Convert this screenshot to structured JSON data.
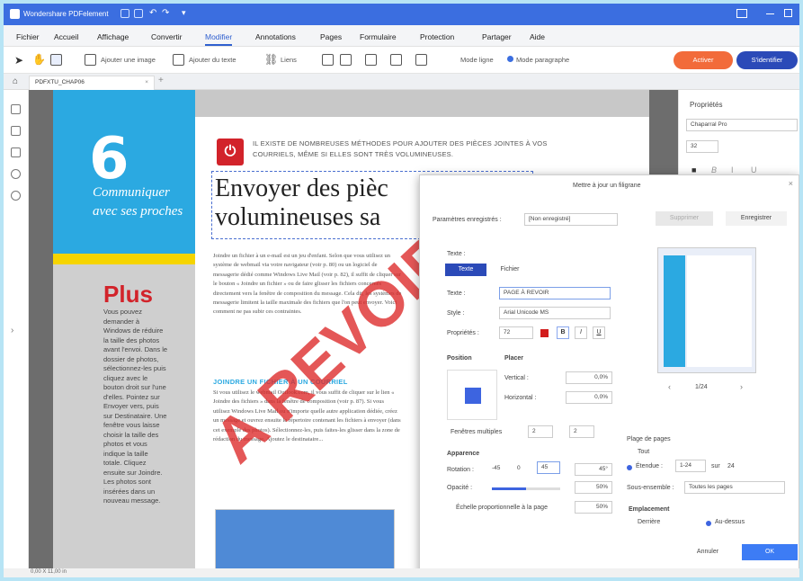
{
  "app": {
    "title": "Wondershare PDFelement",
    "tab": "PDFXTU_CHAP06"
  },
  "menu": {
    "items": [
      "Fichier",
      "Accueil",
      "Affichage",
      "Convertir",
      "Modifier",
      "Annotations",
      "Pages",
      "Formulaire",
      "Protection",
      "Partager",
      "Aide"
    ],
    "active": "Modifier"
  },
  "toolbar": {
    "add_image": "Ajouter une image",
    "add_text": "Ajouter du texte",
    "links": "Liens",
    "mode_line": "Mode ligne",
    "mode_paragraph": "Mode paragraphe",
    "activate": "Activer",
    "identify": "S'identifier"
  },
  "page": {
    "chapter_number": "6",
    "chapter_title": "Communiquer avec ses proches",
    "plus_title": "Plus",
    "plus_text": "Vous pouvez demander à Windows de réduire la taille des photos avant l'envoi. Dans le dossier de photos, sélectionnez-les puis cliquez avec le bouton droit sur l'une d'elles. Pointez sur Envoyer vers, puis sur Destinataire. Une fenêtre vous laisse choisir la taille des photos et vous indique la taille totale. Cliquez ensuite sur Joindre. Les photos sont insérées dans un nouveau message.",
    "intro": "IL EXISTE DE NOMBREUSES MÉTHODES POUR AJOUTER DES PIÈCES JOINTES À VOS COURRIELS, MÊME SI ELLES SONT TRÈS VOLUMINEUSES.",
    "headline": "Envoyer des pièc volumineuses sa",
    "body1": "Joindre un fichier à un e-mail est un jeu d'enfant. Selon que vous utilisez un système de webmail via votre navigateur (voir p. 80) ou un logiciel de messagerie dédié comme Windows Live Mail (voir p. 82), il suffit de cliquer sur le bouton « Joindre un fichier » ou de faire glisser les fichiers concernés directement vers la fenêtre de composition du message. Cela dit, les systèmes de messagerie limitent la taille maximale des fichiers que l'on peut envoyer. Voici comment ne pas subir ces contraintes.",
    "subhead": "JOINDRE UN FICHIER À UN COURRIEL",
    "body2": "Si vous utilisez le webmail Outlook.com, il vous suffit de cliquer sur le lien « Joindre des fichiers » dans la fenêtre de composition (voir p. 87). Si vous utilisez Windows Live Mail ou n'importe quelle autre application dédiée, créez un message et ouvrez ensuite le répertoire contenant les fichiers à envoyer (dans cet exemple des photos). Sélectionnez-les, puis faites-les glisser dans la zone de rédaction du message. Ajoutez le destinataire...",
    "watermark": "A REVOIR"
  },
  "properties": {
    "title": "Propriétés",
    "font": "Chaparral Pro",
    "size": "32"
  },
  "dialog": {
    "title": "Mettre à jour un filigrane",
    "saved_params_label": "Paramètres enregistrés :",
    "saved_params_value": "[Non enregistré]",
    "delete": "Supprimer",
    "save": "Enregistrer",
    "source_label": "Texte :",
    "tab_text": "Texte",
    "tab_file": "Fichier",
    "text_label": "Texte :",
    "text_value": "PAGE À REVOIR",
    "style_label": "Style :",
    "style_value": "Arial Unicode MS",
    "props_label": "Propriétés :",
    "size_value": "72",
    "position_title": "Position",
    "placer_title": "Placer",
    "vertical_label": "Vertical :",
    "vertical_value": "0,0%",
    "horizontal_label": "Horizontal :",
    "horizontal_value": "0,0%",
    "tile_label": "Fenêtres multiples",
    "tile_a": "2",
    "tile_b": "2",
    "appearance_title": "Apparence",
    "rotation_label": "Rotation :",
    "rot1": "-45",
    "rot2": "0",
    "rot3": "45",
    "rot_value": "45°",
    "opacity_label": "Opacité :",
    "opacity_value": "50%",
    "opacity": 0.5,
    "scale_label": "Échelle proportionnelle à la page",
    "scale_value": "50%",
    "range_title": "Plage de pages",
    "all": "Tout",
    "range_label": "Étendue :",
    "range_value": "1-24",
    "of": "sur",
    "total": "24",
    "subset_label": "Sous-ensemble :",
    "subset_value": "Toutes les pages",
    "location_title": "Emplacement",
    "behind": "Derrière",
    "above": "Au-dessus",
    "preview_page": "1/24",
    "cancel": "Annuler",
    "ok": "OK"
  },
  "status": {
    "coords": "0,00 X 11,00 in"
  },
  "colors": {
    "brand": "#3b6ee0",
    "accent": "#f26b3a",
    "ok": "#3d7cf5",
    "chapter_blue": "#2ba9e1",
    "watermark": "#dc2828"
  }
}
